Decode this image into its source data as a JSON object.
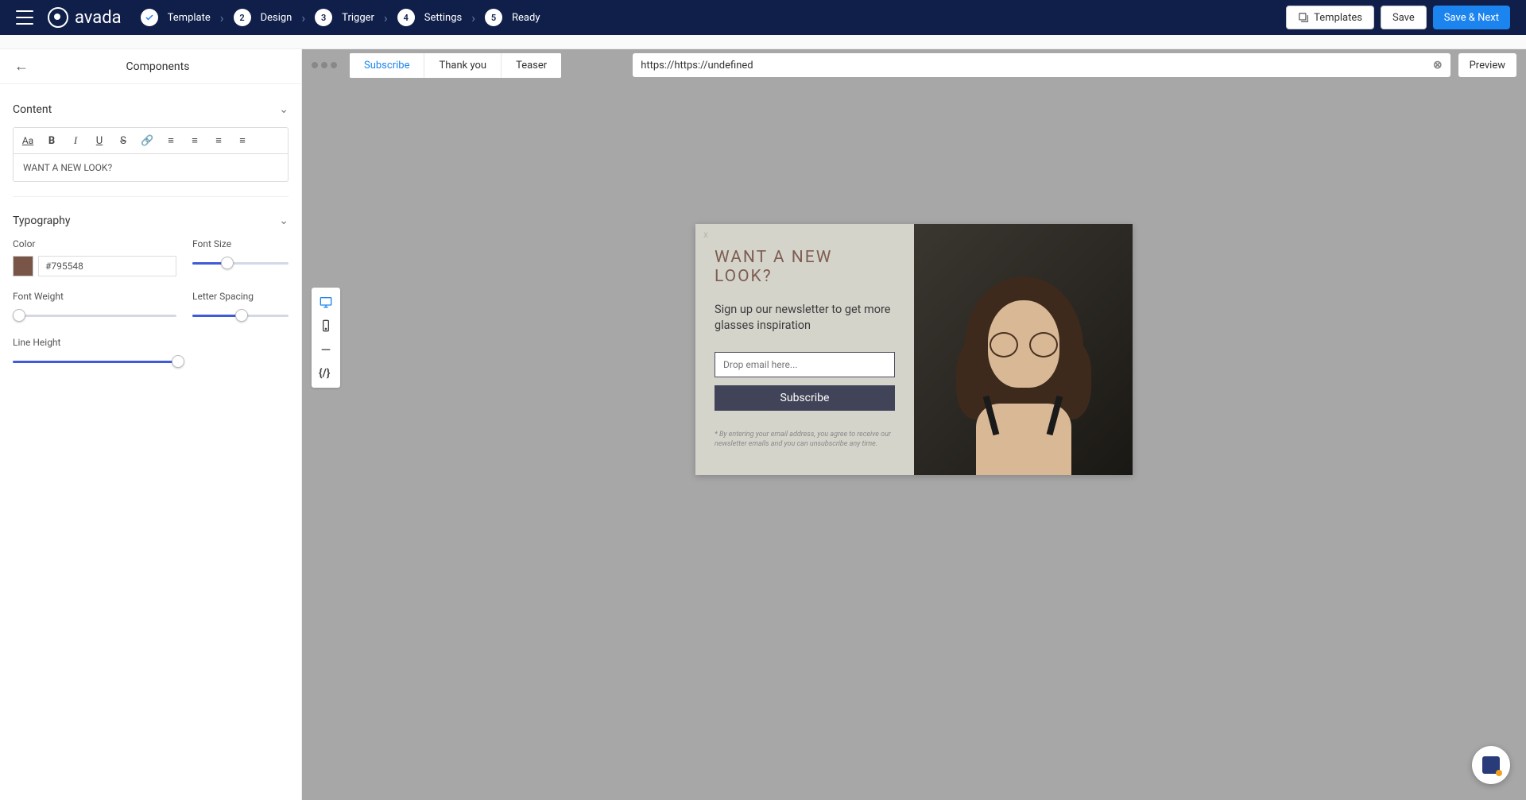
{
  "brand": "avada",
  "steps": [
    {
      "num": "✓",
      "label": "Template",
      "done": true
    },
    {
      "num": "2",
      "label": "Design"
    },
    {
      "num": "3",
      "label": "Trigger"
    },
    {
      "num": "4",
      "label": "Settings"
    },
    {
      "num": "5",
      "label": "Ready"
    }
  ],
  "topbar": {
    "templates": "Templates",
    "save": "Save",
    "save_next": "Save & Next"
  },
  "sidebar": {
    "title": "Components",
    "content": {
      "header": "Content",
      "value": "WANT A NEW LOOK?"
    },
    "typography": {
      "header": "Typography",
      "color_label": "Color",
      "color_value": "#795548",
      "font_size_label": "Font Size",
      "font_weight_label": "Font Weight",
      "letter_spacing_label": "Letter Spacing",
      "line_height_label": "Line Height"
    }
  },
  "canvas": {
    "tabs": [
      "Subscribe",
      "Thank you",
      "Teaser"
    ],
    "active_tab": 0,
    "url": "https://https://undefined",
    "preview": "Preview"
  },
  "popup": {
    "close": "x",
    "title": "WANT A NEW LOOK?",
    "subtitle": "Sign up our newsletter to get more glasses inspiration",
    "placeholder": "Drop email here...",
    "button": "Subscribe",
    "footer": "* By entering your email address, you agree to receive our newsletter emails and you can unsubscribe any time."
  }
}
